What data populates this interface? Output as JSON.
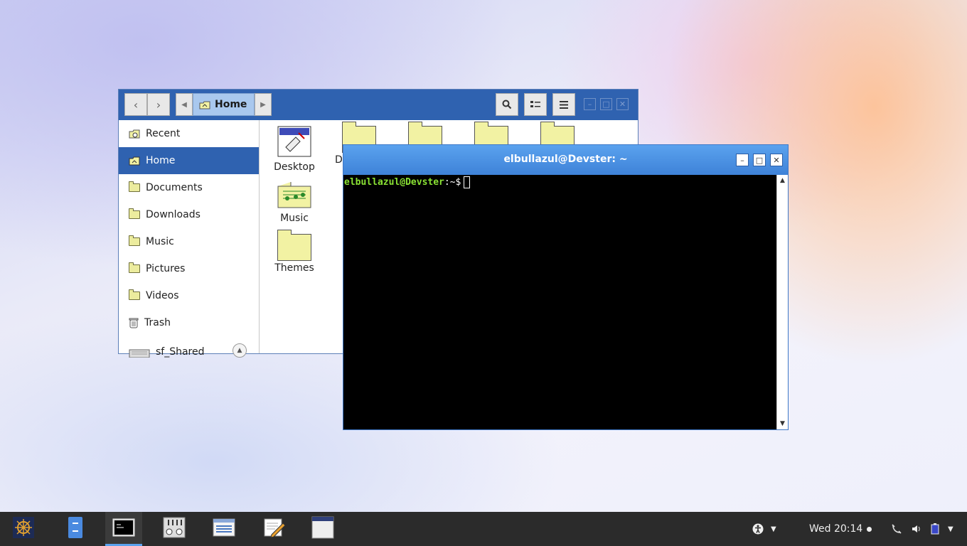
{
  "file_manager": {
    "path_label": "Home",
    "sidebar": [
      {
        "label": "Recent",
        "icon": "recent-icon"
      },
      {
        "label": "Home",
        "icon": "home-icon",
        "active": true
      },
      {
        "label": "Documents",
        "icon": "folder-icon"
      },
      {
        "label": "Downloads",
        "icon": "folder-icon"
      },
      {
        "label": "Music",
        "icon": "folder-icon"
      },
      {
        "label": "Pictures",
        "icon": "folder-icon"
      },
      {
        "label": "Videos",
        "icon": "folder-icon"
      },
      {
        "label": "Trash",
        "icon": "trash-icon"
      },
      {
        "label": "sf_Shared",
        "icon": "drive-icon"
      }
    ],
    "files": [
      {
        "label": "Desktop"
      },
      {
        "label": "Do"
      },
      {
        "label": ""
      },
      {
        "label": ""
      },
      {
        "label": ""
      },
      {
        "label": "Music"
      },
      {
        "label": "Themes"
      }
    ]
  },
  "terminal": {
    "title": "elbullazul@Devster: ~",
    "prompt_user": "elbullazul@Devster",
    "prompt_path": ":~$"
  },
  "taskbar": {
    "clock": "Wed 20:14",
    "apps": [
      "menu-icon",
      "file-manager-icon",
      "terminal-icon",
      "settings-icon",
      "system-monitor-icon",
      "text-editor-icon",
      "window-icon"
    ]
  },
  "colors": {
    "accent": "#2f62b0",
    "terminal_title": "#4a90e2",
    "prompt_green": "#8ae234"
  }
}
